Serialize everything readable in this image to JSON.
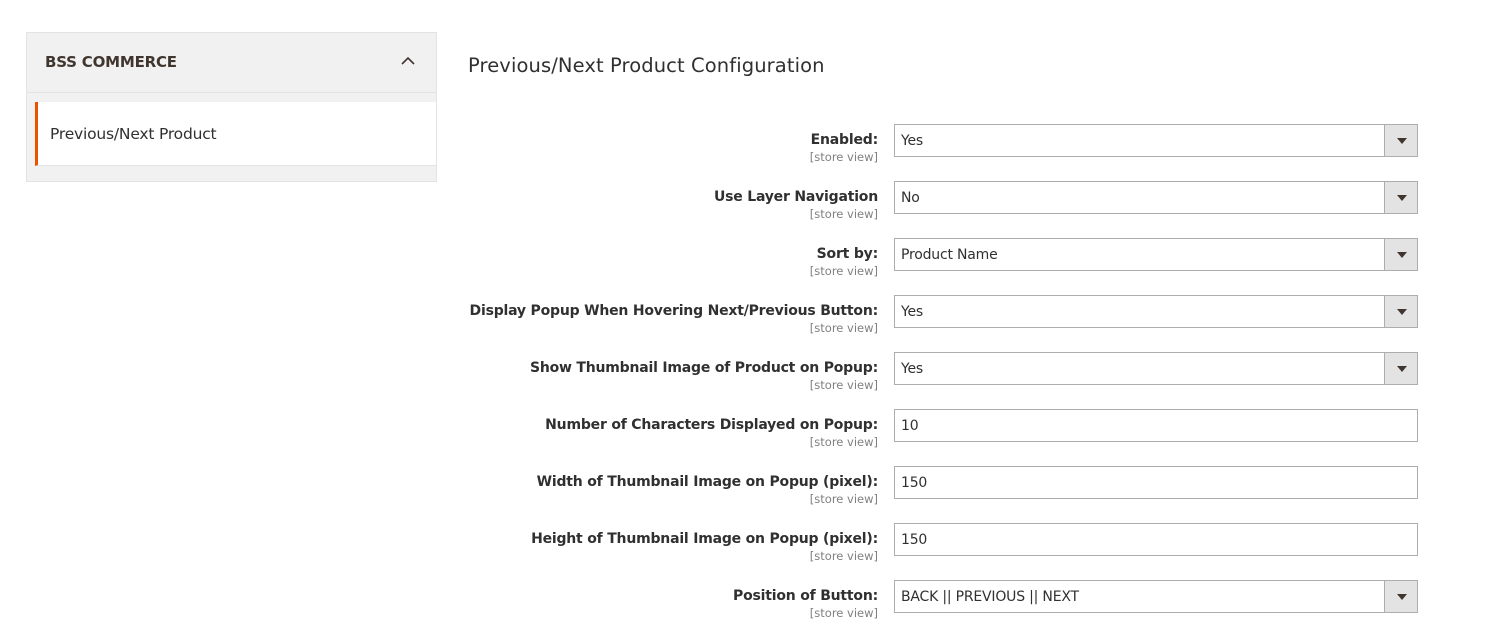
{
  "sidebar": {
    "section_title": "BSS COMMERCE",
    "collapse_icon": "chevron-up-icon",
    "items": [
      {
        "label": "Previous/Next Product",
        "active": true
      }
    ],
    "accent_color": "#eb5202"
  },
  "main": {
    "title": "Previous/Next Product Configuration",
    "fields": [
      {
        "label": "Enabled:",
        "scope": "[store view]",
        "type": "select",
        "value": "Yes"
      },
      {
        "label": "Use Layer Navigation",
        "scope": "[store view]",
        "type": "select",
        "value": "No"
      },
      {
        "label": "Sort by:",
        "scope": "[store view]",
        "type": "select",
        "value": "Product Name"
      },
      {
        "label": "Display Popup When Hovering Next/Previous Button:",
        "scope": "[store view]",
        "type": "select",
        "value": "Yes"
      },
      {
        "label": "Show Thumbnail Image of Product on Popup:",
        "scope": "[store view]",
        "type": "select",
        "value": "Yes"
      },
      {
        "label": "Number of Characters Displayed on Popup:",
        "scope": "[store view]",
        "type": "text",
        "value": "10"
      },
      {
        "label": "Width of Thumbnail Image on Popup (pixel):",
        "scope": "[store view]",
        "type": "text",
        "value": "150"
      },
      {
        "label": "Height of Thumbnail Image on Popup (pixel):",
        "scope": "[store view]",
        "type": "text",
        "value": "150"
      },
      {
        "label": "Position of Button:",
        "scope": "[store view]",
        "type": "select",
        "value": "BACK || PREVIOUS || NEXT"
      }
    ]
  }
}
